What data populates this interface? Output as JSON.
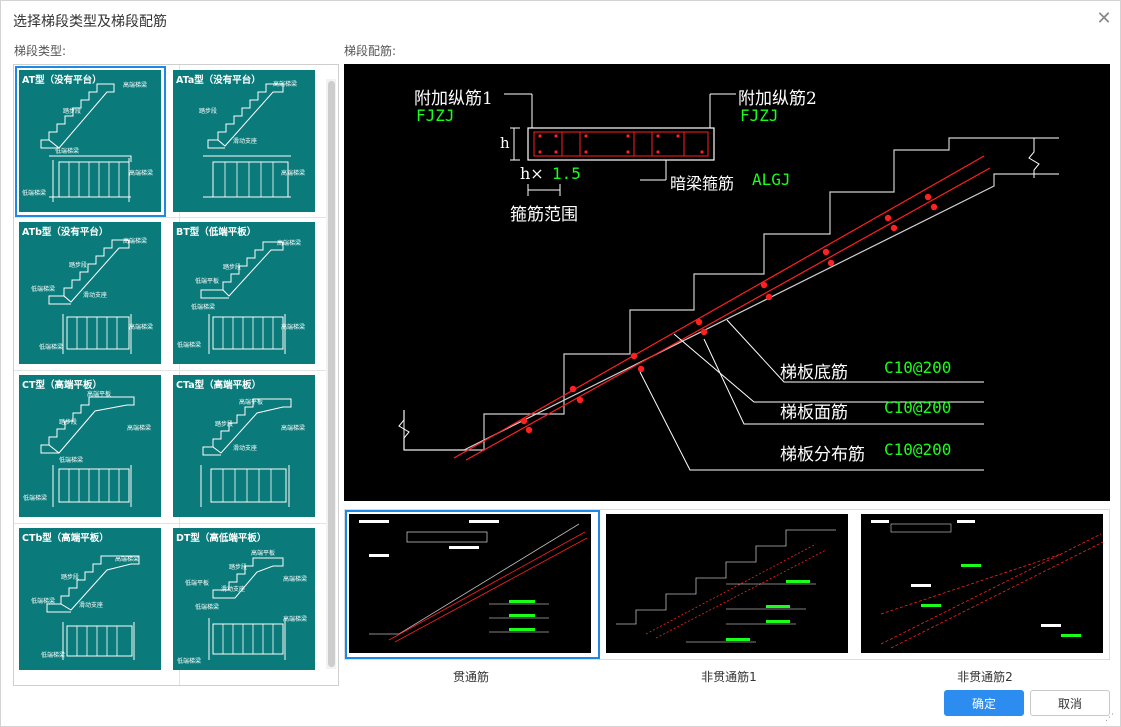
{
  "dialog": {
    "title": "选择梯段类型及梯段配筋",
    "close_icon": "close-icon",
    "left_label": "梯段类型:",
    "right_label": "梯段配筋:",
    "ok_label": "确定",
    "cancel_label": "取消"
  },
  "stair_types": [
    {
      "title": "AT型（没有平台）",
      "labels": [
        "高端梯梁",
        "踏步段",
        "低端梯梁",
        "高端梯梁",
        "低端梯梁"
      ]
    },
    {
      "title": "ATa型（没有平台）",
      "labels": [
        "高端梯梁",
        "踏步段",
        "滑动支座",
        "高端梯梁"
      ]
    },
    {
      "title": "ATb型（没有平台）",
      "labels": [
        "高端梯梁",
        "踏步段",
        "低端梯梁",
        "滑动支座",
        "高端梯梁",
        "低端梯梁"
      ]
    },
    {
      "title": "BT型（低端平板）",
      "labels": [
        "高端梯梁",
        "踏步段",
        "低端平板",
        "低端梯梁",
        "高端梯梁",
        "低端梯梁"
      ]
    },
    {
      "title": "CT型（高端平板）",
      "labels": [
        "高端平板",
        "踏步段",
        "高端梯梁",
        "低端梯梁",
        "低端梯梁"
      ]
    },
    {
      "title": "CTa型（高端平板）",
      "labels": [
        "高端平板",
        "踏步段",
        "高端梯梁",
        "滑动支座"
      ]
    },
    {
      "title": "CTb型（高端平板）",
      "labels": [
        "高端梯梁",
        "踏步段",
        "低端梯梁",
        "滑动支座",
        "低端梯梁"
      ]
    },
    {
      "title": "DT型（高低端平板）",
      "labels": [
        "高端平板",
        "踏步段",
        "低端平板",
        "高端梯梁",
        "滑动支座",
        "低端梯梁",
        "高端梯梁",
        "低端梯梁"
      ]
    }
  ],
  "main_drawing": {
    "label_fjzj1": "附加纵筋1",
    "code_fjzj1": "FJZJ",
    "label_fjzj2": "附加纵筋2",
    "code_fjzj2": "FJZJ",
    "h_label": "h",
    "h_times": "h×",
    "factor": "1.5",
    "stirrup_range": "箍筋范围",
    "algj_label": "暗梁箍筋",
    "algj_code": "ALGJ",
    "rows": [
      {
        "name": "梯板底筋",
        "value": "C10@200"
      },
      {
        "name": "梯板面筋",
        "value": "C10@200"
      },
      {
        "name": "梯板分布筋",
        "value": "C10@200"
      }
    ],
    "colors": {
      "red": "#ff2020",
      "green": "#19ff19",
      "white": "#ffffff"
    }
  },
  "rebar_options": [
    {
      "caption": "贯通筋",
      "selected": true
    },
    {
      "caption": "非贯通筋1",
      "selected": false
    },
    {
      "caption": "非贯通筋2",
      "selected": false
    }
  ],
  "accent_color": "#2d8cf0"
}
